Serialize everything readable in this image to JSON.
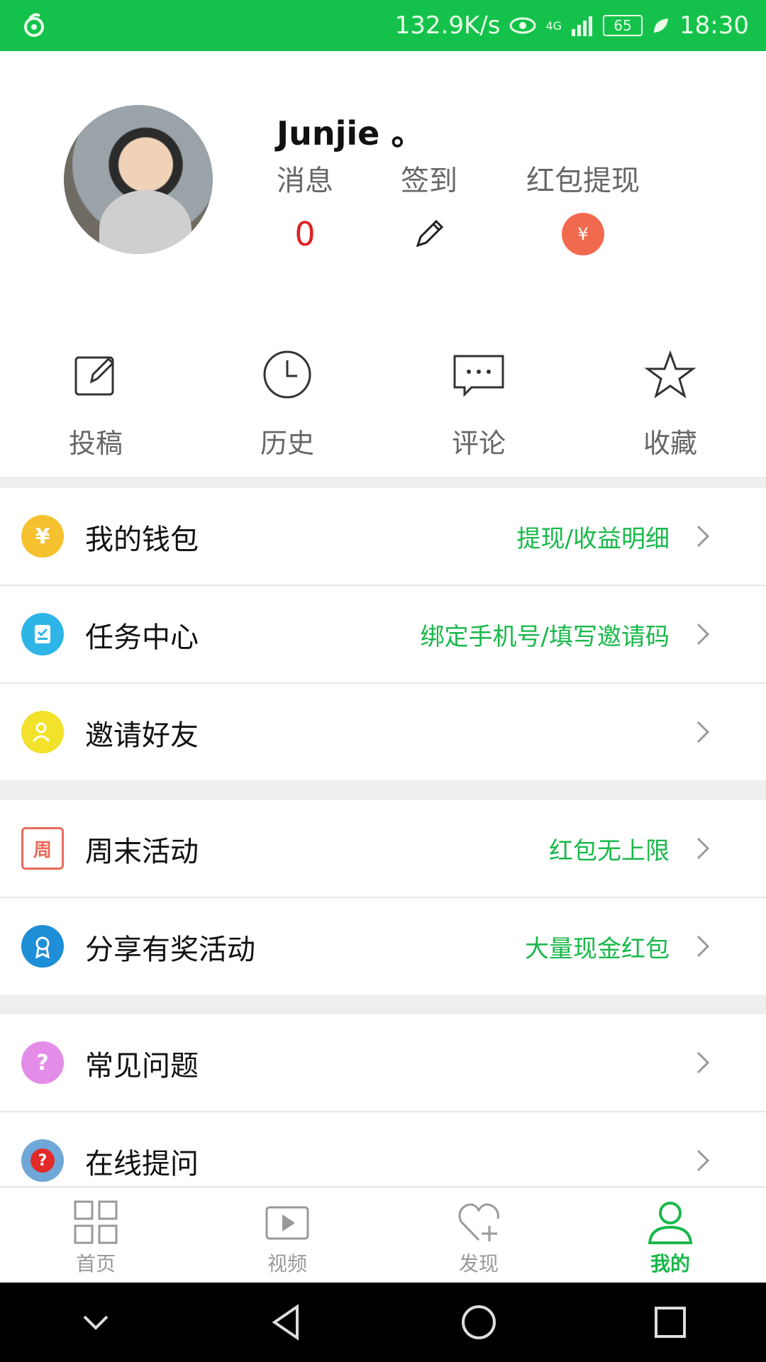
{
  "status": {
    "speed": "132.9K/s",
    "signal": "4G",
    "battery": "65",
    "time": "18:30"
  },
  "profile": {
    "username": "Junjie 。",
    "stats": [
      {
        "label": "消息",
        "value": "0"
      },
      {
        "label": "签到",
        "icon": "pencil-icon"
      },
      {
        "label": "红包提现",
        "icon": "red-packet-icon",
        "icon_text": "¥"
      }
    ]
  },
  "quick_actions": [
    {
      "label": "投稿",
      "icon": "edit-icon"
    },
    {
      "label": "历史",
      "icon": "clock-icon"
    },
    {
      "label": "评论",
      "icon": "comment-icon"
    },
    {
      "label": "收藏",
      "icon": "star-icon"
    }
  ],
  "menu": {
    "wallet": {
      "title": "我的钱包",
      "hint": "提现/收益明细",
      "icon": "money-bag-icon",
      "color": "#f5c12e"
    },
    "tasks": {
      "title": "任务中心",
      "hint": "绑定手机号/填写邀请码",
      "icon": "task-icon",
      "color": "#2eb5e8"
    },
    "invite": {
      "title": "邀请好友",
      "hint": "",
      "icon": "invite-user-icon",
      "color": "#f2e22a"
    },
    "weekend": {
      "title": "周末活动",
      "hint": "红包无上限",
      "icon": "calendar-icon",
      "icon_text": "周",
      "color": "#e86b5a"
    },
    "share": {
      "title": "分享有奖活动",
      "hint": "大量现金红包",
      "icon": "award-icon",
      "color": "#1e8ed6"
    },
    "faq": {
      "title": "常见问题",
      "hint": "",
      "icon": "question-icon",
      "color": "#e48de8"
    },
    "ask": {
      "title": "在线提问",
      "hint": "",
      "icon": "chat-question-icon",
      "color": "#6fa8d8"
    }
  },
  "bottom_nav": [
    {
      "label": "首页",
      "icon": "grid-icon",
      "active": false
    },
    {
      "label": "视频",
      "icon": "video-play-icon",
      "active": false
    },
    {
      "label": "发现",
      "icon": "heart-plus-icon",
      "active": false
    },
    {
      "label": "我的",
      "icon": "user-icon",
      "active": true
    }
  ],
  "colors": {
    "brand_green": "#14c24b",
    "hint_green": "#19b84a",
    "alert_red": "#e02020"
  }
}
